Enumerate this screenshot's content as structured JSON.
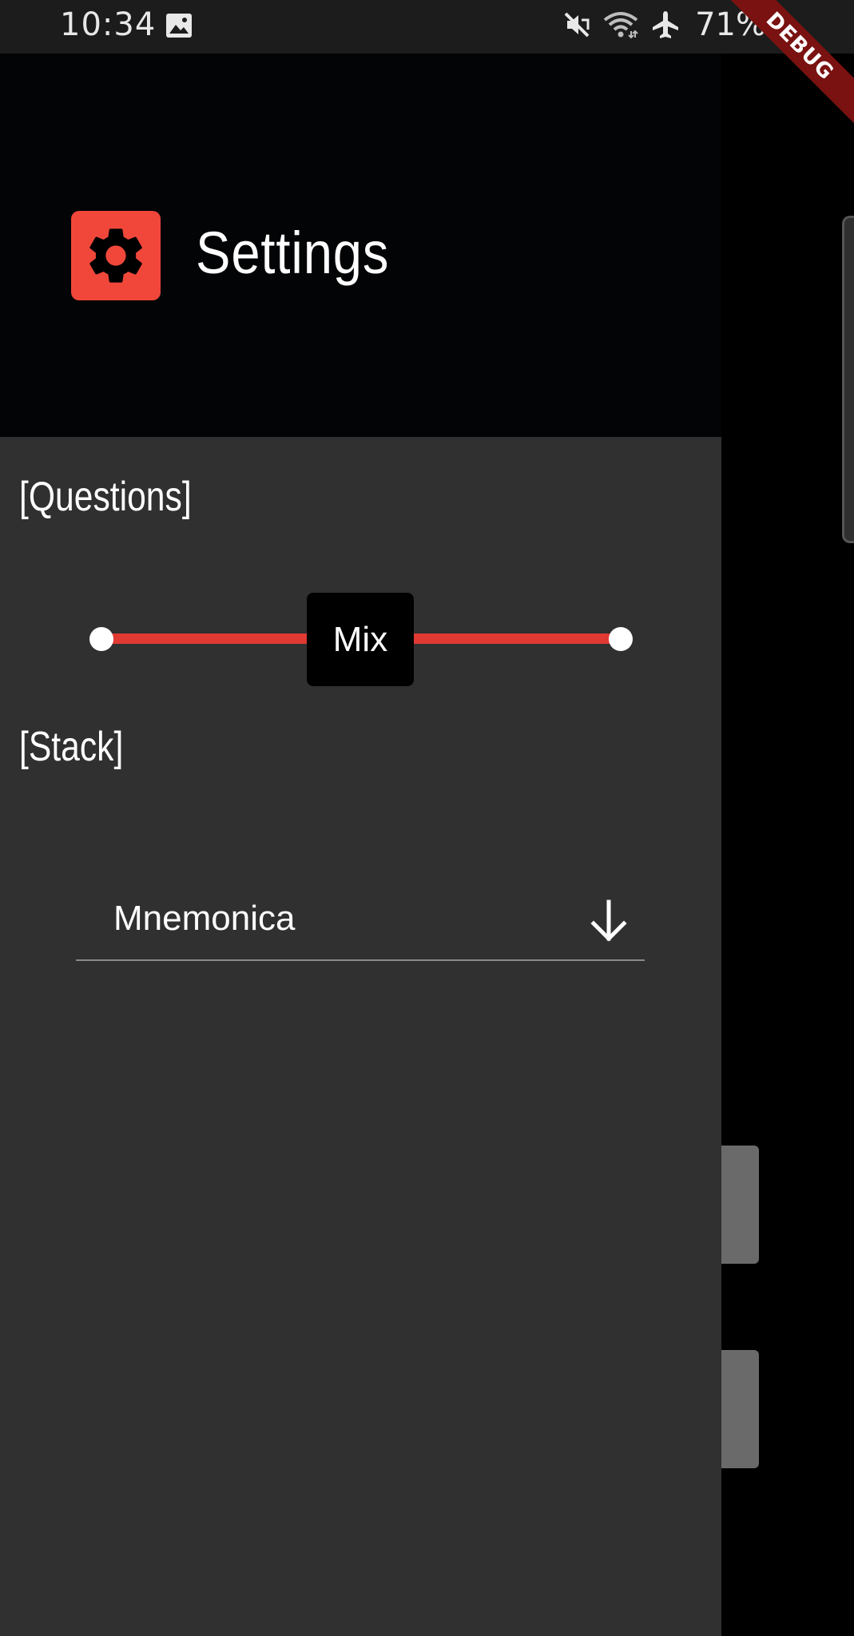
{
  "status_bar": {
    "time": "10:34",
    "battery": "71%",
    "icons": [
      "image-icon",
      "mute-icon",
      "wifi-icon",
      "airplane-icon",
      "battery-icon"
    ]
  },
  "debug_banner": "DEBUG",
  "drawer": {
    "header": {
      "icon": "gear-icon",
      "title": "Settings",
      "icon_color": "#f0473a"
    },
    "questions": {
      "label": "[Questions]",
      "slider_value_label": "Mix",
      "accent_color": "#e03a33"
    },
    "stack": {
      "label": "[Stack]",
      "selected": "Mnemonica"
    }
  }
}
